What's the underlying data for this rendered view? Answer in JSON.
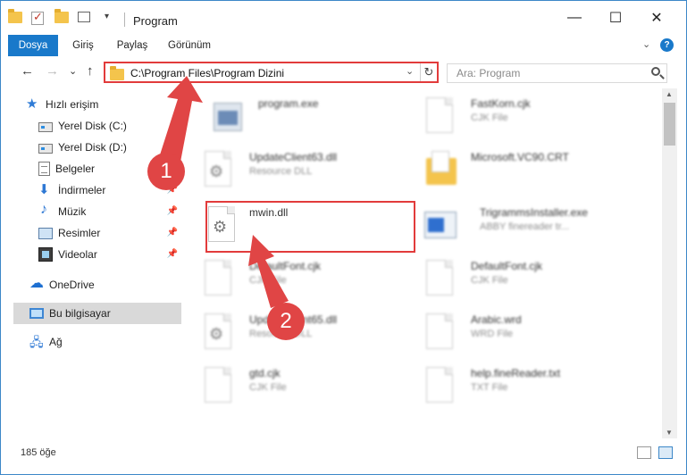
{
  "titlebar": {
    "title": "Program",
    "minimize": "—",
    "maximize": "☐",
    "close": "✕"
  },
  "ribbon": {
    "tabs": [
      "Dosya",
      "Giriş",
      "Paylaş",
      "Görünüm"
    ],
    "expand": "⌄",
    "help": "?"
  },
  "nav": {
    "back": "←",
    "forward": "→",
    "recent": "⌄",
    "up": "↑"
  },
  "address": {
    "path": "C:\\Program Files\\Program Dizini",
    "dropdown": "⌄",
    "refresh": "↻"
  },
  "search": {
    "placeholder": "Ara: Program"
  },
  "sidebar": {
    "items": [
      {
        "label": "Hızlı erişim",
        "icon": "star-icon"
      },
      {
        "label": "Yerel Disk (C:)",
        "icon": "drive-icon"
      },
      {
        "label": "Yerel Disk (D:)",
        "icon": "drive-icon"
      },
      {
        "label": "Belgeler",
        "icon": "documents-icon"
      },
      {
        "label": "İndirmeler",
        "icon": "downloads-icon"
      },
      {
        "label": "Müzik",
        "icon": "music-icon"
      },
      {
        "label": "Resimler",
        "icon": "pictures-icon"
      },
      {
        "label": "Videolar",
        "icon": "videos-icon"
      },
      {
        "label": "OneDrive",
        "icon": "cloud-icon"
      },
      {
        "label": "Bu bilgisayar",
        "icon": "computer-icon"
      },
      {
        "label": "Ağ",
        "icon": "network-icon"
      }
    ]
  },
  "files": {
    "left": [
      {
        "name": "program.exe",
        "type": ""
      },
      {
        "name": "UpdateClient63.dll",
        "type": "Resource DLL"
      },
      {
        "name": "mwin.dll",
        "type": ""
      },
      {
        "name": "DefaultFont.cjk",
        "type": "CJK File"
      },
      {
        "name": "UpdateClient65.dll",
        "type": "Resource DLL"
      },
      {
        "name": "gtd.cjk",
        "type": "CJK File"
      }
    ],
    "right": [
      {
        "name": "FastKorn.cjk",
        "type": "CJK File"
      },
      {
        "name": "Microsoft.VC90.CRT",
        "type": ""
      },
      {
        "name": "TrigrammsInstaller.exe",
        "type": "ABBY finereader tr..."
      },
      {
        "name": "DefaultFont.cjk",
        "type": "CJK File"
      },
      {
        "name": "Arabic.wrd",
        "type": "WRD File"
      },
      {
        "name": "help.fineReader.txt",
        "type": "TXT File"
      }
    ]
  },
  "status": {
    "count": "185 öğe"
  },
  "callouts": {
    "one": "1",
    "two": "2"
  },
  "colors": {
    "accent": "#1979ca",
    "highlight": "#e23b3b"
  }
}
